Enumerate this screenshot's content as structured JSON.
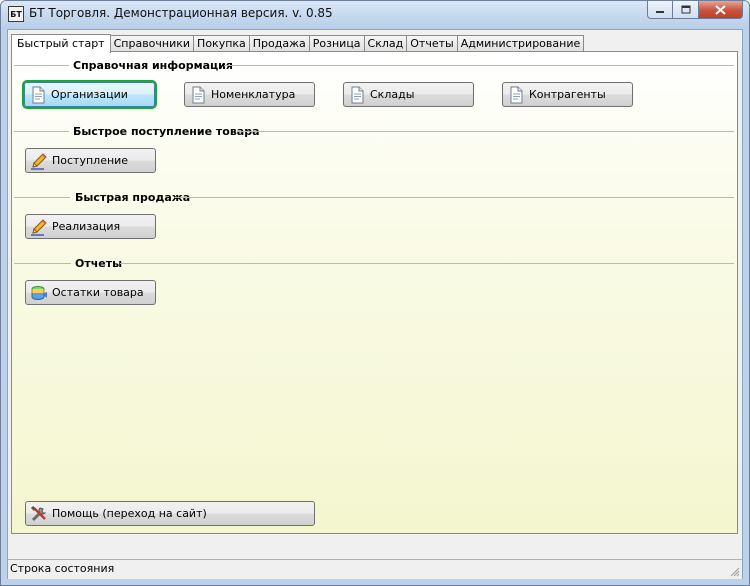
{
  "window": {
    "app_icon_text": "БТ",
    "title": "БТ Торговля. Демонстрационная версия. v. 0.85"
  },
  "tabs": [
    {
      "label": "Быстрый старт",
      "active": true
    },
    {
      "label": "Справочники"
    },
    {
      "label": "Покупка"
    },
    {
      "label": "Продажа"
    },
    {
      "label": "Розница"
    },
    {
      "label": "Склад"
    },
    {
      "label": "Отчеты"
    },
    {
      "label": "Администрирование"
    }
  ],
  "sections": {
    "reference": {
      "title": "Справочная информация",
      "buttons": [
        {
          "label": "Организации",
          "icon": "document-icon"
        },
        {
          "label": "Номенклатура",
          "icon": "document-icon"
        },
        {
          "label": "Склады",
          "icon": "document-icon"
        },
        {
          "label": "Контрагенты",
          "icon": "document-icon"
        }
      ]
    },
    "receipt": {
      "title": "Быстрое поступление товара",
      "button": {
        "label": "Поступление",
        "icon": "pencil-icon"
      }
    },
    "sale": {
      "title": "Быстрая продажа",
      "button": {
        "label": "Реализация",
        "icon": "pencil-icon"
      }
    },
    "reports": {
      "title": "Отчеты",
      "button": {
        "label": "Остатки товара",
        "icon": "database-icon"
      }
    }
  },
  "help_button": {
    "label": "Помощь (переход на сайт)",
    "icon": "tools-icon"
  },
  "status_bar": {
    "text": "Строка состояния"
  },
  "colors": {
    "focus_ring": "#1ea52b",
    "panel_gradient_end": "#f4f6cf"
  }
}
